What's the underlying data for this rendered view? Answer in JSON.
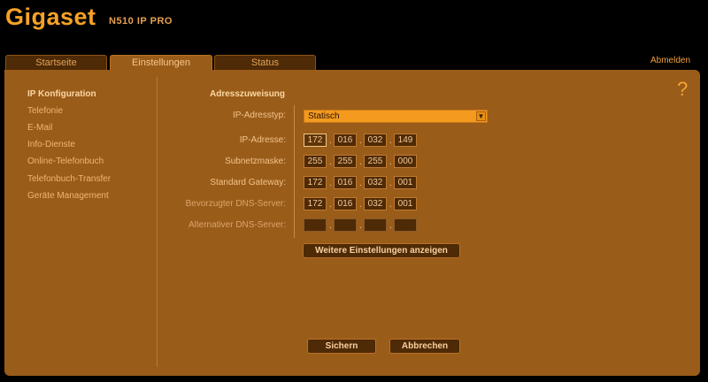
{
  "brand": {
    "name": "Gigaset",
    "model": "N510 IP PRO"
  },
  "tabs": [
    {
      "label": "Startseite"
    },
    {
      "label": "Einstellungen"
    },
    {
      "label": "Status"
    }
  ],
  "logout": "Abmelden",
  "help": "?",
  "sidebar": {
    "items": [
      {
        "label": "IP Konfiguration"
      },
      {
        "label": "Telefonie"
      },
      {
        "label": "E-Mail"
      },
      {
        "label": "Info-Dienste"
      },
      {
        "label": "Online-Telefonbuch"
      },
      {
        "label": "Telefonbuch-Transfer"
      },
      {
        "label": "Geräte Management"
      }
    ]
  },
  "form": {
    "section_title": "Adresszuweisung",
    "ip_type": {
      "label": "IP-Adresstyp:",
      "value": "Statisch"
    },
    "ip_address": {
      "label": "IP-Adresse:",
      "octets": [
        "172",
        "016",
        "032",
        "149"
      ]
    },
    "subnet_mask": {
      "label": "Subnetzmaske:",
      "octets": [
        "255",
        "255",
        "255",
        "000"
      ]
    },
    "gateway": {
      "label": "Standard Gateway:",
      "octets": [
        "172",
        "016",
        "032",
        "001"
      ]
    },
    "dns_primary": {
      "label": "Bevorzugter DNS-Server:",
      "octets": [
        "172",
        "016",
        "032",
        "001"
      ]
    },
    "dns_secondary": {
      "label": "Alternativer DNS-Server:",
      "octets": [
        "",
        "",
        "",
        ""
      ]
    },
    "more_settings_label": "Weitere Einstellungen anzeigen"
  },
  "actions": {
    "save_label": "Sichern",
    "cancel_label": "Abbrechen"
  }
}
